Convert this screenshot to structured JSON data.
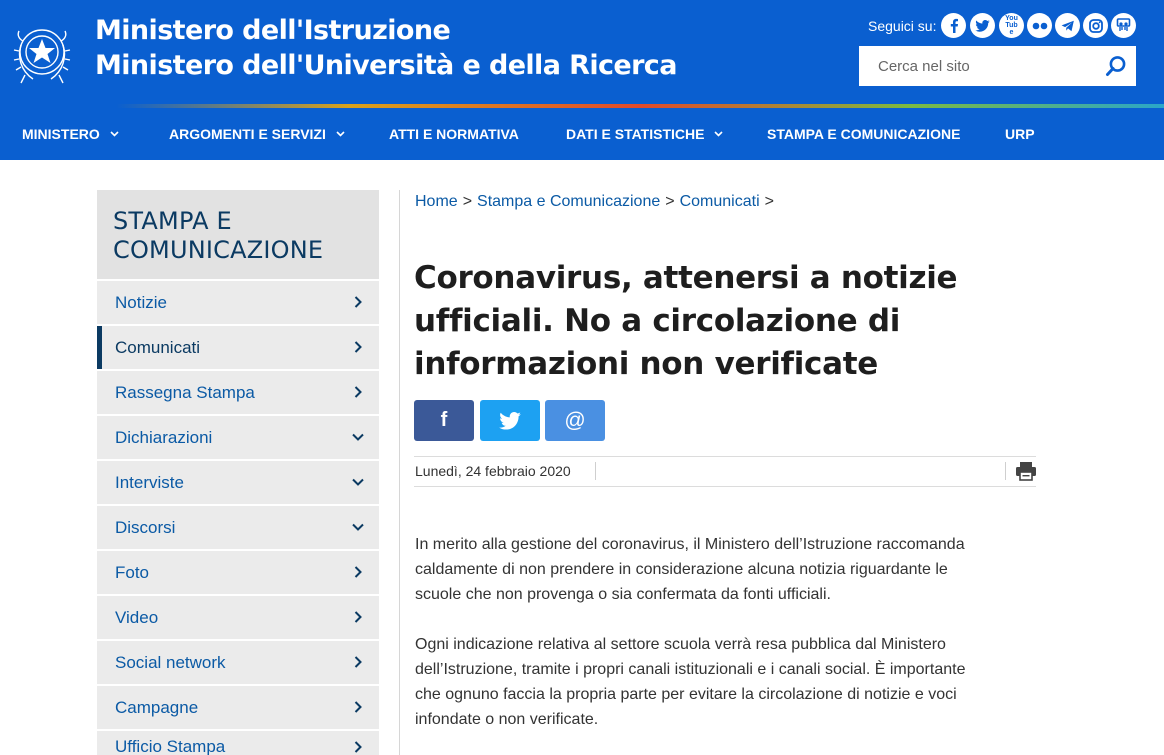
{
  "header": {
    "title_line1": "Ministero dell'Istruzione",
    "title_line2": "Ministero dell'Università e della Ricerca",
    "follow_label": "Seguici su:",
    "socials": [
      "facebook-icon",
      "twitter-icon",
      "youtube-icon",
      "flickr-icon",
      "telegram-icon",
      "instagram-icon",
      "slideshare-icon"
    ],
    "youtube_text": "You Tube",
    "search": {
      "placeholder": "Cerca nel sito"
    }
  },
  "nav": {
    "items": [
      {
        "label": "MINISTERO",
        "has_dropdown": true
      },
      {
        "label": "ARGOMENTI E SERVIZI",
        "has_dropdown": true
      },
      {
        "label": "ATTI E NORMATIVA",
        "has_dropdown": false
      },
      {
        "label": "DATI E STATISTICHE",
        "has_dropdown": true
      },
      {
        "label": "STAMPA E COMUNICAZIONE",
        "has_dropdown": false
      },
      {
        "label": "URP",
        "has_dropdown": false
      }
    ]
  },
  "sidebar": {
    "title": "STAMPA E COMUNICAZIONE",
    "items": [
      {
        "label": "Notizie",
        "icon": "chevron-right-icon"
      },
      {
        "label": "Comunicati",
        "icon": "chevron-right-icon",
        "active": true
      },
      {
        "label": "Rassegna Stampa",
        "icon": "chevron-right-icon"
      },
      {
        "label": "Dichiarazioni",
        "icon": "chevron-down-icon"
      },
      {
        "label": "Interviste",
        "icon": "chevron-down-icon"
      },
      {
        "label": "Discorsi",
        "icon": "chevron-down-icon"
      },
      {
        "label": "Foto",
        "icon": "chevron-right-icon"
      },
      {
        "label": "Video",
        "icon": "chevron-right-icon"
      },
      {
        "label": "Social network",
        "icon": "chevron-right-icon"
      },
      {
        "label": "Campagne",
        "icon": "chevron-right-icon"
      },
      {
        "label": "Ufficio Stampa",
        "icon": "chevron-right-icon"
      }
    ]
  },
  "breadcrumb": {
    "items": [
      "Home",
      "Stampa e Comunicazione",
      "Comunicati"
    ],
    "separator": ">"
  },
  "article": {
    "title": "Coronavirus, attenersi a notizie ufficiali. No a circolazione di informazioni non verificate",
    "share": {
      "facebook_glyph": "f",
      "email_glyph": "@",
      "colors": {
        "facebook": "#3b5998",
        "twitter": "#1da1f2",
        "email": "#4a90e2"
      }
    },
    "date": "Lunedì, 24 febbraio 2020",
    "paragraphs": [
      "In merito alla gestione del coronavirus, il Ministero dell’Istruzione raccomanda caldamente di non prendere in considerazione alcuna notizia riguardante le scuole che non provenga o sia confermata da fonti ufficiali.",
      "Ogni indicazione relativa al settore scuola verrà resa pubblica dal Ministero dell’Istruzione, tramite i propri canali istituzionali e i canali social. È importante che ognuno faccia la propria parte per evitare la circolazione di notizie e voci infondate o non verificate."
    ]
  },
  "colors": {
    "primary_blue": "#0a5fd0",
    "sidebar_title": "#0b3a62",
    "link_blue": "#0b5aa5",
    "sidebar_bg": "#ebebeb"
  }
}
